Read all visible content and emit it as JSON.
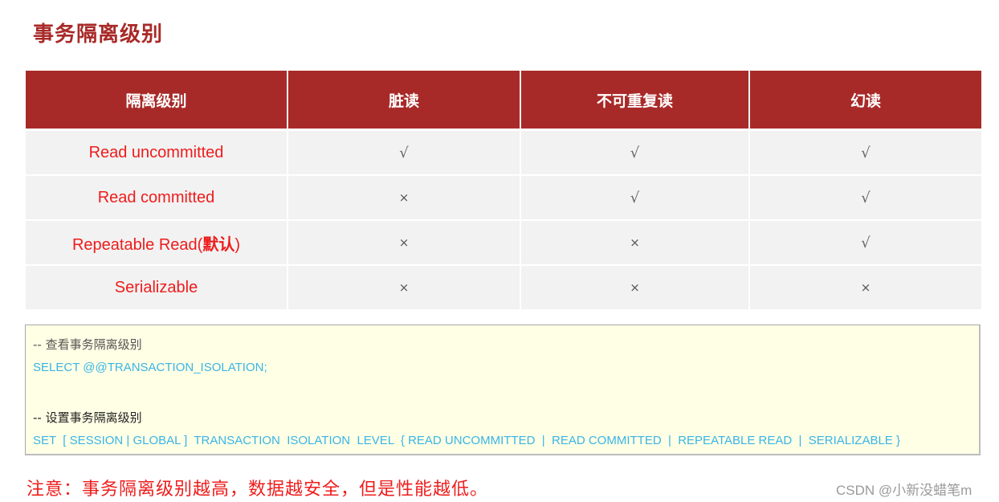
{
  "title": "事务隔离级别",
  "table": {
    "headers": [
      "隔离级别",
      "脏读",
      "不可重复读",
      "幻读"
    ],
    "rows": [
      {
        "level": "Read uncommitted",
        "level_suffix": "",
        "dirty_read": "√",
        "non_repeatable_read": "√",
        "phantom_read": "√"
      },
      {
        "level": "Read committed",
        "level_suffix": "",
        "dirty_read": "×",
        "non_repeatable_read": "√",
        "phantom_read": "√"
      },
      {
        "level": "Repeatable Read(",
        "level_suffix": "默认",
        "level_close": ")",
        "dirty_read": "×",
        "non_repeatable_read": "×",
        "phantom_read": "√"
      },
      {
        "level": "Serializable",
        "level_suffix": "",
        "dirty_read": "×",
        "non_repeatable_read": "×",
        "phantom_read": "×"
      }
    ]
  },
  "code": {
    "comment_view": "-- 查看事务隔离级别",
    "select_stmt": "SELECT @@TRANSACTION_ISOLATION;",
    "comment_set": "-- 设置事务隔离级别",
    "set_stmt": "SET  [ SESSION | GLOBAL ]  TRANSACTION  ISOLATION  LEVEL  { READ UNCOMMITTED  |  READ COMMITTED  |  REPEATABLE READ  |  SERIALIZABLE }"
  },
  "note": "注意：事务隔离级别越高，数据越安全，但是性能越低。",
  "watermark": "CSDN @小新没蜡笔m",
  "colors": {
    "header_bg": "#a82a28",
    "level_text": "#ee1c1c",
    "sql_text": "#3ab4e6",
    "code_bg": "#ffffe6",
    "row_bg": "#f2f2f2"
  }
}
